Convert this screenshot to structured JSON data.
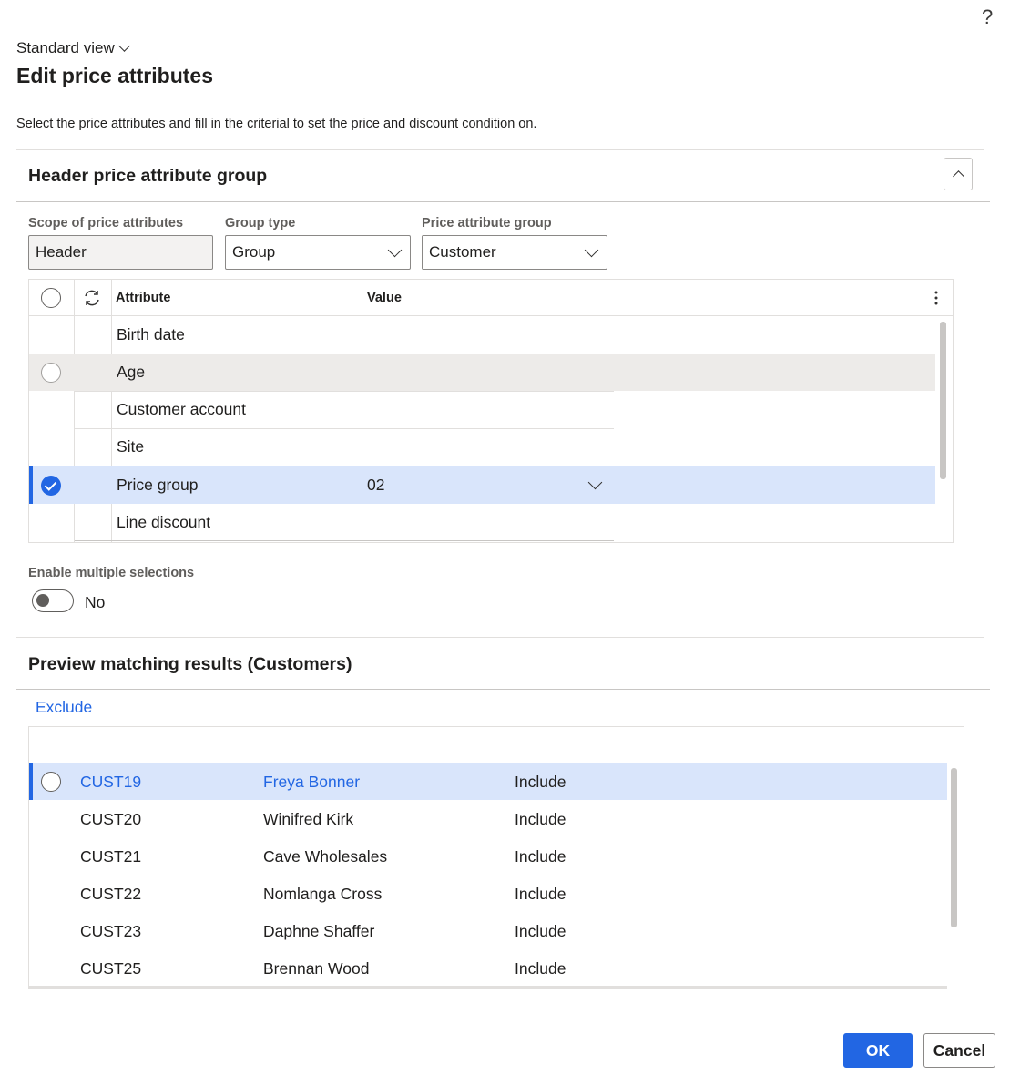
{
  "help": {
    "glyph": "?"
  },
  "view": {
    "label": "Standard view"
  },
  "page": {
    "title": "Edit price attributes",
    "description": "Select the price attributes and fill in the criterial to set the price and discount condition on."
  },
  "header_section": {
    "title": "Header price attribute group",
    "fields": {
      "scope": {
        "label": "Scope of price attributes",
        "value": "Header"
      },
      "group_type": {
        "label": "Group type",
        "value": "Group"
      },
      "price_attribute_group": {
        "label": "Price attribute group",
        "value": "Customer"
      }
    },
    "grid": {
      "columns": {
        "attribute": "Attribute",
        "value": "Value"
      },
      "rows": [
        {
          "attribute": "Birth date",
          "value": ""
        },
        {
          "attribute": "Age",
          "value": ""
        },
        {
          "attribute": "Customer account",
          "value": ""
        },
        {
          "attribute": "Site",
          "value": ""
        },
        {
          "attribute": "Price group",
          "value": "02"
        },
        {
          "attribute": "Line discount",
          "value": ""
        }
      ]
    },
    "multi_select": {
      "label": "Enable multiple selections",
      "value": "No"
    }
  },
  "preview_section": {
    "title": "Preview matching results (Customers)",
    "exclude_label": "Exclude",
    "rows": [
      {
        "id": "CUST19",
        "name": "Freya Bonner",
        "status": "Include"
      },
      {
        "id": "CUST20",
        "name": "Winifred Kirk",
        "status": "Include"
      },
      {
        "id": "CUST21",
        "name": "Cave Wholesales",
        "status": "Include"
      },
      {
        "id": "CUST22",
        "name": "Nomlanga Cross",
        "status": "Include"
      },
      {
        "id": "CUST23",
        "name": "Daphne Shaffer",
        "status": "Include"
      },
      {
        "id": "CUST25",
        "name": "Brennan Wood",
        "status": "Include"
      }
    ]
  },
  "footer": {
    "ok_label": "OK",
    "cancel_label": "Cancel"
  },
  "colors": {
    "accent": "#2266e3",
    "selected_row": "#d9e5fb",
    "hover_row": "#edebe9"
  }
}
